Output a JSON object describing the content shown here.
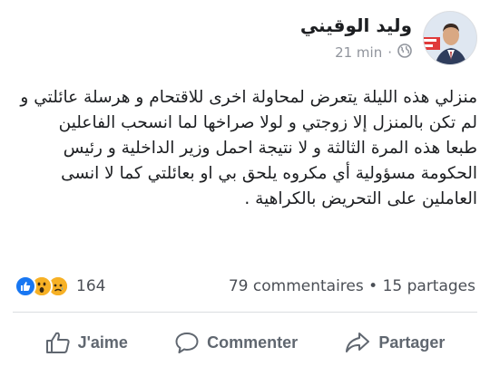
{
  "post": {
    "author": "وليد الوقيني",
    "time": "21 min",
    "separator": "·",
    "paragraphs": [
      "منزلي هذه الليلة يتعرض لمحاولة اخرى للاقتحام و هرسلة عائلتي و لم تكن بالمنزل إلا زوجتي و لولا صراخها لما انسحب الفاعلين",
      "طبعا هذه المرة الثالثة و لا نتيجة احمل وزير الداخلية و رئيس الحكومة مسؤولية أي مكروه يلحق بي او بعائلتي كما لا انسى العاملين على التحريض بالكراهية ."
    ]
  },
  "stats": {
    "reaction_icons": [
      "like-icon",
      "wow-icon",
      "sad-icon"
    ],
    "reaction_count": "164",
    "comments_shares": "79 commentaires • 15 partages"
  },
  "actions": {
    "like": "J'aime",
    "comment": "Commenter",
    "share": "Partager"
  },
  "colors": {
    "like_blue": "#1877f2",
    "reaction_yellow": "#f7b125",
    "muted_text": "#606770"
  }
}
